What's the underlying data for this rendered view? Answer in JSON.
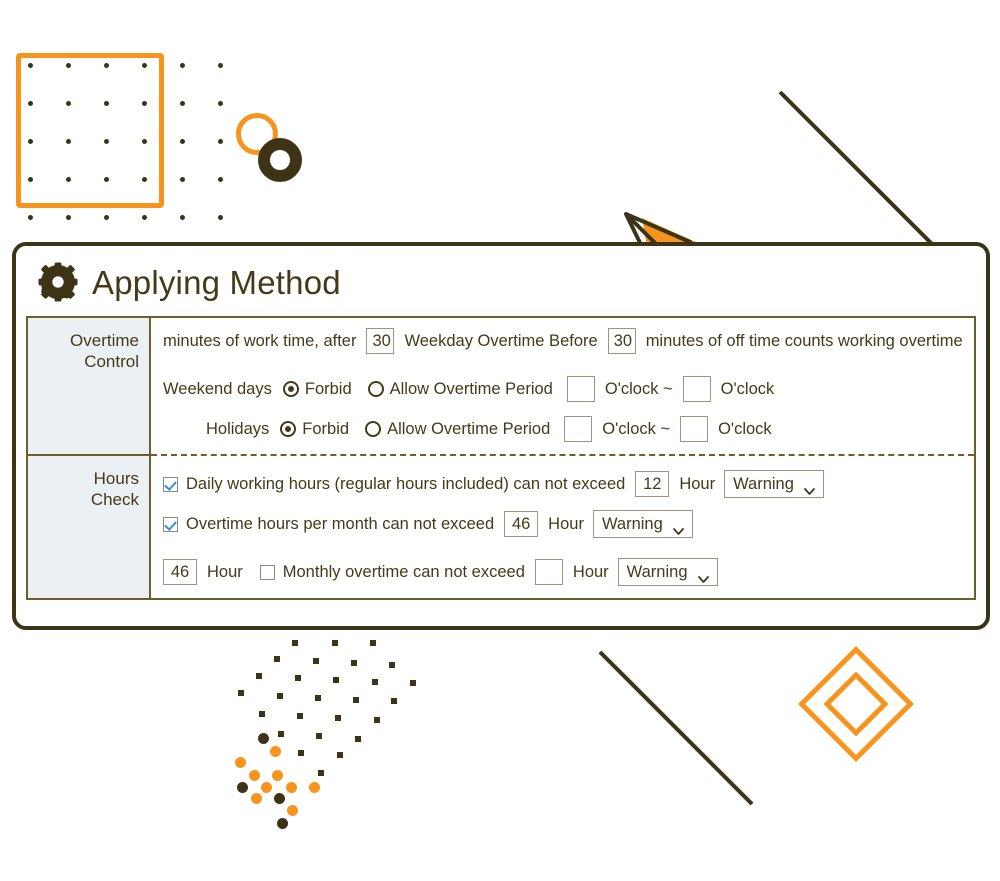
{
  "panel": {
    "title": "Applying Method",
    "icon": "gear-icon"
  },
  "table": {
    "rows": [
      {
        "label": "Overtime\nControl",
        "label_line1": "Overtime",
        "label_line2": "Control"
      },
      {
        "label_line1": "Hours",
        "label_line2": "Check"
      }
    ]
  },
  "overtime_control": {
    "weekday": {
      "text_before": "minutes of work time, after",
      "value1": "30",
      "text_middle": "Weekday Overtime Before",
      "value2": "30",
      "text_after": "minutes of off time counts working overtime"
    },
    "weekend": {
      "label": "Weekend days",
      "forbid_label": "Forbid",
      "forbid_selected": true,
      "allow_label": "Allow Overtime Period",
      "allow_selected": false,
      "time_from": "",
      "oclock_from": "O'clock ~",
      "time_to": "",
      "oclock_to": "O'clock"
    },
    "holidays": {
      "label": "Holidays",
      "forbid_label": "Forbid",
      "forbid_selected": true,
      "allow_label": "Allow Overtime Period",
      "allow_selected": false,
      "time_from": "",
      "oclock_from": "O'clock ~",
      "time_to": "",
      "oclock_to": "O'clock"
    }
  },
  "hours_check": {
    "daily": {
      "checked": true,
      "label": "Daily working hours (regular hours included) can not exceed",
      "value": "12",
      "unit": "Hour",
      "action": "Warning"
    },
    "monthly_overtime": {
      "checked": true,
      "label": "Overtime hours per month can not exceed",
      "value": "46",
      "unit": "Hour",
      "action": "Warning"
    },
    "monthly": {
      "value_left": "46",
      "unit_left": "Hour",
      "checked": false,
      "label": "Monthly overtime can not exceed",
      "value": "",
      "unit": "Hour",
      "action": "Warning"
    }
  },
  "colors": {
    "orange": "#f7941e",
    "dark_brown": "#3d3418",
    "text": "#453a18",
    "label_bg": "#eaf0f3",
    "table_border": "#6e5e27",
    "check_blue": "#3a8fd4"
  }
}
